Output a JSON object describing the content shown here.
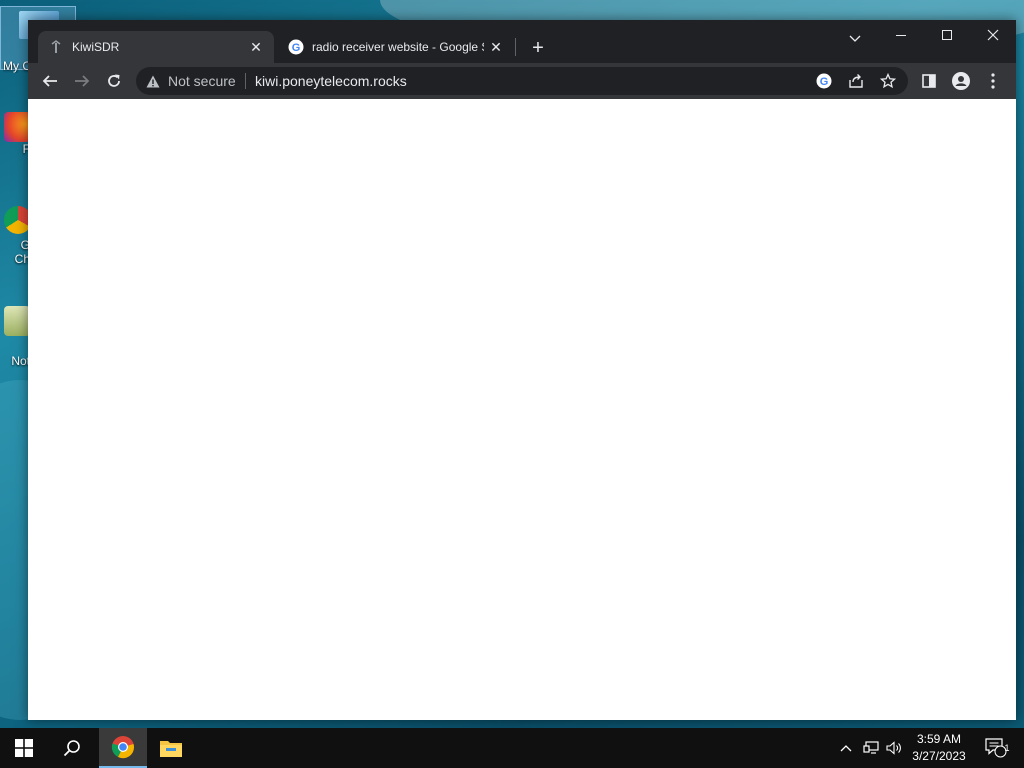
{
  "desktop": {
    "icons": [
      {
        "name": "my-computer",
        "label": "My C"
      },
      {
        "name": "firefox",
        "label": "F"
      },
      {
        "name": "google-chrome",
        "label": "G\nCh"
      },
      {
        "name": "notepad",
        "label": "Not"
      }
    ]
  },
  "browser": {
    "tabs": [
      {
        "title": "KiwiSDR",
        "icon": "kiwisdr-favicon",
        "active": true
      },
      {
        "title": "radio receiver website - Google S",
        "icon": "google-favicon",
        "active": false
      }
    ],
    "omnibox": {
      "security_label": "Not secure",
      "url": "kiwi.poneytelecom.rocks"
    },
    "colors": {
      "frame": "#202124",
      "toolbar": "#35363a",
      "text": "#e8eaed"
    }
  },
  "taskbar": {
    "clock": {
      "time": "3:59 AM",
      "date": "3/27/2023"
    },
    "notification_count": "1",
    "apps": [
      "chrome",
      "file-explorer"
    ]
  }
}
